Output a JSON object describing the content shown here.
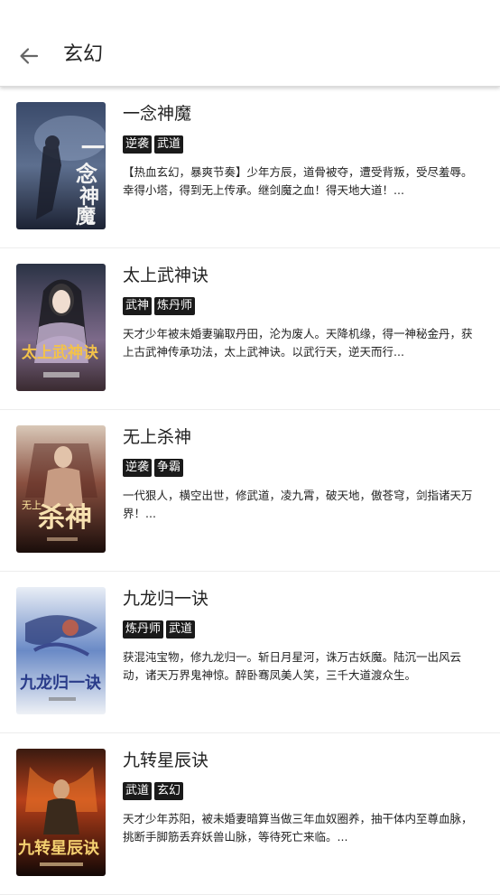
{
  "header": {
    "title": "玄幻",
    "back_icon": "arrow-left-icon"
  },
  "books": [
    {
      "title": "一念神魔",
      "tags": [
        "逆袭",
        "武道"
      ],
      "description": "【热血玄幻，暴爽节奏】少年方辰，道骨被夺，遭受背叛，受尽羞辱。幸得小塔，得到无上传承。继剑魔之血！得天地大道！...",
      "cover_text": "一念神魔"
    },
    {
      "title": "太上武神诀",
      "tags": [
        "武神",
        "炼丹师"
      ],
      "description": "天才少年被未婚妻骗取丹田，沦为废人。天降机缘，得一神秘金丹，获上古武神传承功法，太上武神诀。以武行天，逆天而行...",
      "cover_text": "太上武神诀"
    },
    {
      "title": "无上杀神",
      "tags": [
        "逆袭",
        "争霸"
      ],
      "description": "一代狠人，横空出世，修武道，凌九霄，破天地，傲苍穹，剑指诸天万界！...",
      "cover_text": "无上杀神"
    },
    {
      "title": "九龙归一诀",
      "tags": [
        "炼丹师",
        "武道"
      ],
      "description": "获混沌宝物，修九龙归一。斩日月星河，诛万古妖魔。陆沉一出风云动，诸天万界鬼神惊。醉卧骞凤美人笑，三千大道渡众生。",
      "cover_text": "九龙归一诀"
    },
    {
      "title": "九转星辰诀",
      "tags": [
        "武道",
        "玄幻"
      ],
      "description": "天才少年苏阳，被未婚妻暗算当做三年血奴圈养，抽干体内至尊血脉，挑断手脚筋丢弃妖兽山脉，等待死亡来临。...",
      "cover_text": "九转星辰诀"
    }
  ]
}
